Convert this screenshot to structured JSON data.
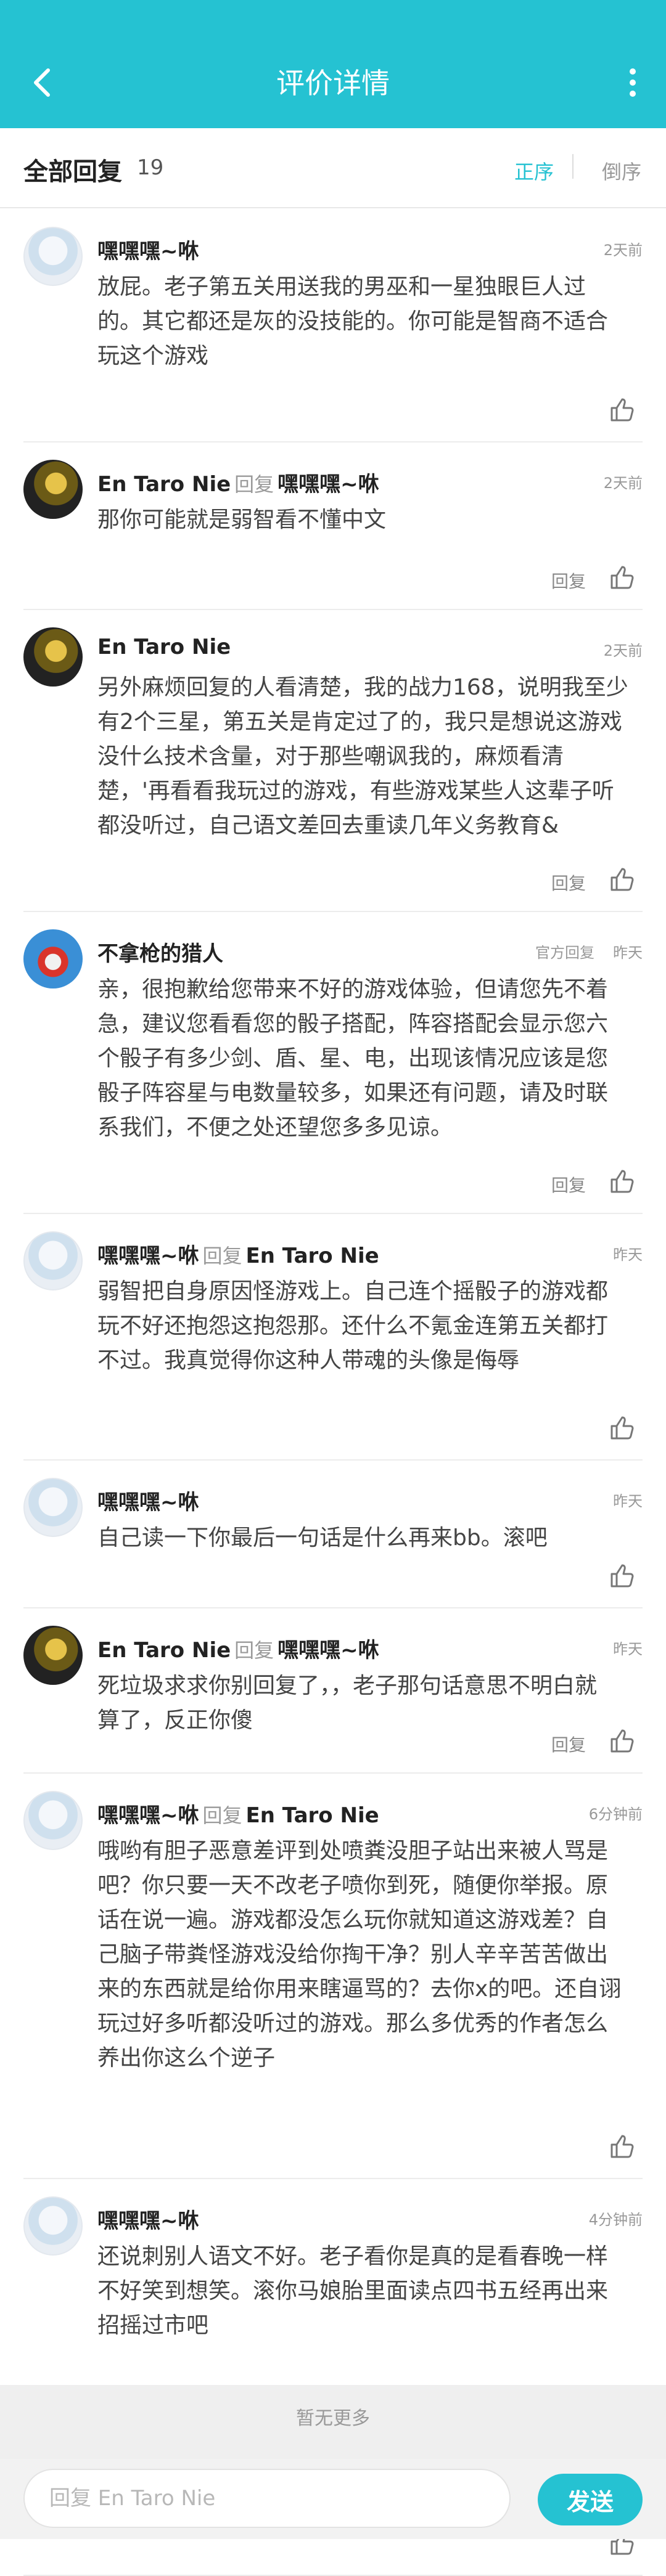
{
  "header": {
    "title": "评价详情"
  },
  "subheader": {
    "label": "全部回复",
    "count": "19",
    "sort_asc": "正序",
    "sort_desc": "倒序"
  },
  "reply_word": "回复",
  "replies": [
    {
      "author": "嘿嘿嘿~咻",
      "reply_to": "",
      "time": "2天前",
      "badge": "",
      "avatar": "boy",
      "content": "放屁。老子第五关用送我的男巫和一星独眼巨人过\n的。其它都还是灰的没技能的。你可能是智商不适合\n玩这个游戏",
      "reply_label": ""
    },
    {
      "author": "En Taro Nie",
      "reply_to": "嘿嘿嘿~咻",
      "time": "2天前",
      "badge": "",
      "avatar": "dark",
      "content": "那你可能就是弱智看不懂中文",
      "reply_label": "回复"
    },
    {
      "author": "En Taro Nie",
      "reply_to": "",
      "time": "2天前",
      "badge": "",
      "avatar": "dark",
      "content": "另外麻烦回复的人看清楚，我的战力168，说明我至少\n有2个三星，第五关是肯定过了的，我只是想说这游戏\n没什么技术含量，对于那些嘲讽我的，麻烦看清\n楚，'再看看我玩过的游戏，有些游戏某些人这辈子听\n都没听过，自己语文差回去重读几年义务教育&",
      "reply_label": "回复"
    },
    {
      "author": "不拿枪的猎人",
      "reply_to": "",
      "time": "昨天",
      "badge": "官方回复",
      "avatar": "robot",
      "content": "亲，很抱歉给您带来不好的游戏体验，但请您先不着\n急，建议您看看您的骰子搭配，阵容搭配会显示您六\n个骰子有多少剑、盾、星、电，出现该情况应该是您\n骰子阵容星与电数量较多，如果还有问题，请及时联\n系我们，不便之处还望您多多见谅。",
      "reply_label": "回复"
    },
    {
      "author": "嘿嘿嘿~咻",
      "reply_to": "En Taro Nie",
      "time": "昨天",
      "badge": "",
      "avatar": "boy",
      "content": "弱智把自身原因怪游戏上。自己连个摇骰子的游戏都\n玩不好还抱怨这抱怨那。还什么不氪金连第五关都打\n不过。我真觉得你这种人带魂的头像是侮辱",
      "reply_label": ""
    },
    {
      "author": "嘿嘿嘿~咻",
      "reply_to": "",
      "time": "昨天",
      "badge": "",
      "avatar": "boy",
      "content": "自己读一下你最后一句话是什么再来bb。滚吧",
      "reply_label": ""
    },
    {
      "author": "En Taro Nie",
      "reply_to": "嘿嘿嘿~咻",
      "time": "昨天",
      "badge": "",
      "avatar": "dark",
      "content": "死垃圾求求你别回复了，，老子那句话意思不明白就\n算了，反正你傻",
      "reply_label": "回复"
    },
    {
      "author": "嘿嘿嘿~咻",
      "reply_to": "En Taro Nie",
      "time": "6分钟前",
      "badge": "",
      "avatar": "boy",
      "content": "哦哟有胆子恶意差评到处喷粪没胆子站出来被人骂是\n吧？你只要一天不改老子喷你到死，随便你举报。原\n话在说一遍。游戏都没怎么玩你就知道这游戏差？自\n己脑子带粪怪游戏没给你掏干净？别人辛辛苦苦做出\n来的东西就是给你用来瞎逼骂的？去你x的吧。还自诩\n玩过好多听都没听过的游戏。那么多优秀的作者怎么\n养出你这么个逆子",
      "reply_label": ""
    },
    {
      "author": "嘿嘿嘿~咻",
      "reply_to": "",
      "time": "4分钟前",
      "badge": "",
      "avatar": "boy",
      "content": "还说刺别人语文不好。老子看你是真的是看春晚一样\n不好笑到想笑。滚你马娘胎里面读点四书五经再出来\n招摇过市吧",
      "reply_label": ""
    }
  ],
  "footer": {
    "no_more": "暂无更多"
  },
  "bottom": {
    "placeholder": "回复 En Taro Nie",
    "send_label": "发送"
  },
  "colors": {
    "accent": "#25c2d2"
  }
}
